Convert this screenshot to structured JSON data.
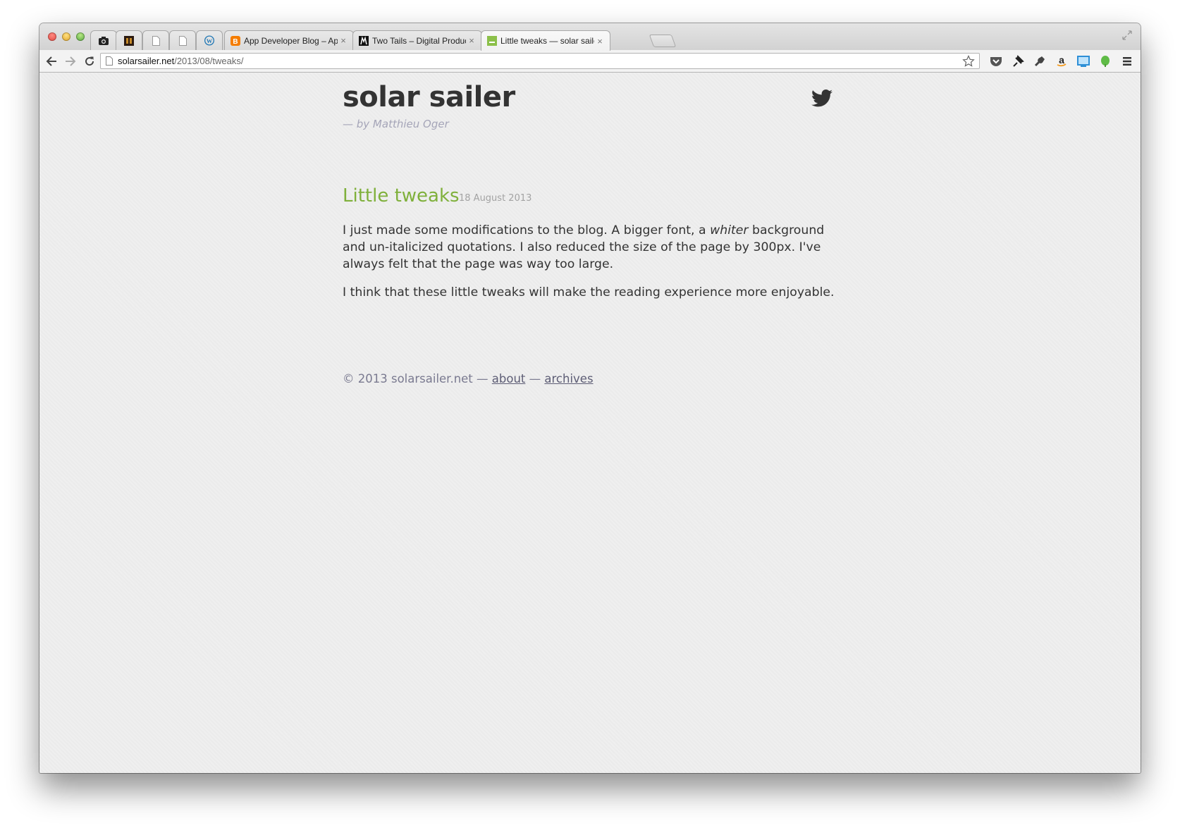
{
  "browser": {
    "tabs": [
      {
        "title": "",
        "icon": "camera-icon"
      },
      {
        "title": "",
        "icon": "dark-app-icon"
      },
      {
        "title": "",
        "icon": "blank-page-icon"
      },
      {
        "title": "",
        "icon": "blank-page-icon"
      },
      {
        "title": "",
        "icon": "wordpress-icon"
      },
      {
        "title": "App Developer Blog – App",
        "icon": "blogger-icon",
        "close": "×"
      },
      {
        "title": "Two Tails – Digital Produc",
        "icon": "twotails-icon",
        "close": "×"
      },
      {
        "title": "Little tweaks — solar sailer",
        "icon": "solarsailer-icon",
        "close": "×",
        "active": true
      }
    ],
    "url": {
      "host": "solarsailer.net",
      "path": "/2013/08/tweaks/"
    },
    "extensions": [
      "pocket-icon",
      "pin-icon",
      "wrench-icon",
      "amazon-icon",
      "screenshot-icon",
      "evernote-icon",
      "menu-icon"
    ],
    "accent_colors": {
      "close": "#e0443e",
      "minimize": "#dea123",
      "maximize": "#4fa23a"
    }
  },
  "site": {
    "title": "solar sailer",
    "byline": "— by Matthieu Oger",
    "twitter_icon": "twitter-icon"
  },
  "post": {
    "title": "Little tweaks",
    "date": "18 August 2013",
    "p1_before": "I just made some modifications to the blog. A bigger font, a ",
    "p1_em": "whiter",
    "p1_after": " background and un-italicized quotations. I also reduced the size of the page by 300px. I've always felt that the page was way too large.",
    "p2": "I think that these little tweaks will make the reading experience more enjoyable."
  },
  "footer": {
    "copyright": "© 2013 solarsailer.net —",
    "sep": "—",
    "about": "about",
    "archives": "archives"
  },
  "colors": {
    "post_title": "#7fb03b",
    "byline": "#a5a5b8",
    "background": "#efefef"
  }
}
